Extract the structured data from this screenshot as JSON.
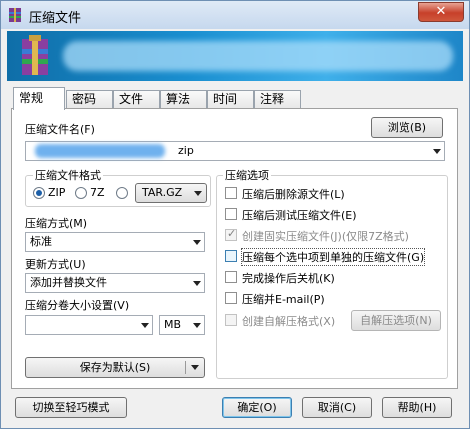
{
  "window": {
    "title": "压缩文件",
    "close_glyph": "✕"
  },
  "tabs": [
    {
      "label": "常规"
    },
    {
      "label": "密码"
    },
    {
      "label": "文件"
    },
    {
      "label": "算法"
    },
    {
      "label": "时间"
    },
    {
      "label": "注释"
    }
  ],
  "general": {
    "filename_label": "压缩文件名(F)",
    "browse_button": "浏览(B)",
    "filename_value": "zip",
    "format_group": "压缩文件格式",
    "format_options": [
      "ZIP",
      "7Z",
      "TAR.GZ"
    ],
    "format_selected": "ZIP",
    "method_label": "压缩方式(M)",
    "method_value": "标准",
    "update_label": "更新方式(U)",
    "update_value": "添加并替换文件",
    "split_label": "压缩分卷大小设置(V)",
    "split_value": "",
    "split_unit": "MB",
    "save_default_button": "保存为默认(S)",
    "options_group": "压缩选项",
    "options": [
      {
        "label": "压缩后删除源文件(L)",
        "checked": false,
        "disabled": false
      },
      {
        "label": "压缩后测试压缩文件(E)",
        "checked": false,
        "disabled": false
      },
      {
        "label": "创建固实压缩文件(J)(仅限7Z格式)",
        "checked": true,
        "disabled": true
      },
      {
        "label": "压缩每个选中项到单独的压缩文件(G)",
        "checked": false,
        "disabled": false
      },
      {
        "label": "完成操作后关机(K)",
        "checked": false,
        "disabled": false
      },
      {
        "label": "压缩并E-mail(P)",
        "checked": false,
        "disabled": false
      },
      {
        "label": "创建自解压格式(X)",
        "checked": false,
        "disabled": true
      }
    ],
    "sfx_options_button": "自解压选项(N)"
  },
  "footer": {
    "lite_mode_button": "切换至轻巧模式",
    "ok_button": "确定(O)",
    "cancel_button": "取消(C)",
    "help_button": "帮助(H)"
  },
  "colors": {
    "accent": "#3c7fb1",
    "banner": "#1a8fd0",
    "close": "#c7402a"
  }
}
